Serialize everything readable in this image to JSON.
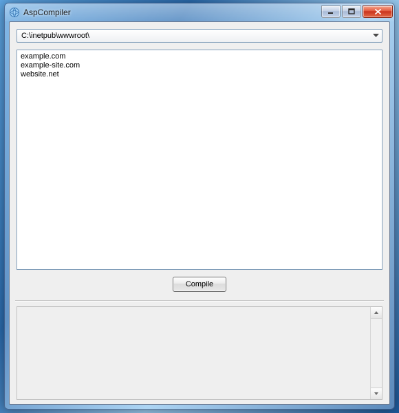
{
  "window": {
    "title": "AspCompiler"
  },
  "dropdown": {
    "value": "C:\\inetpub\\wwwroot\\"
  },
  "list": {
    "items": [
      "example.com",
      "example-site.com",
      "website.net"
    ]
  },
  "actions": {
    "compile_label": "Compile"
  },
  "output": {
    "text": ""
  }
}
